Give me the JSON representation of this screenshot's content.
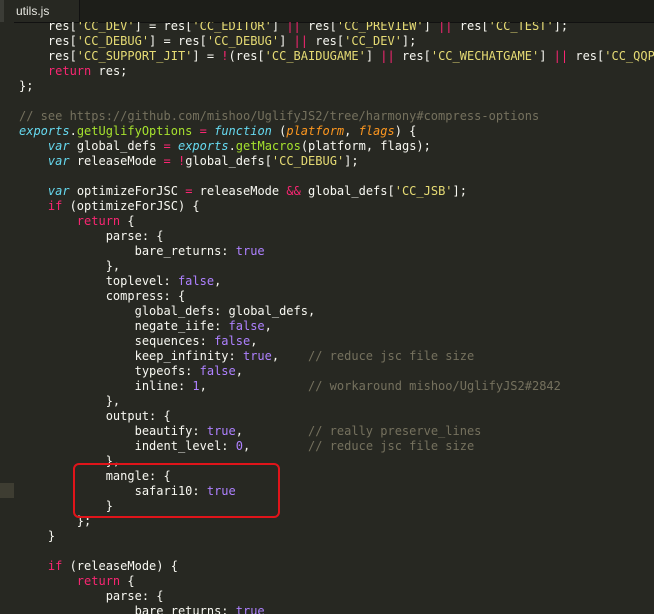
{
  "tab": {
    "label": "utils.js"
  },
  "lines": [
    [
      "    res[",
      {
        "t": "'CC_DEV'",
        "c": "str"
      },
      "] = res[",
      {
        "t": "'CC_EDITOR'",
        "c": "str"
      },
      "] ",
      {
        "t": "||",
        "c": "kw"
      },
      " res[",
      {
        "t": "'CC_PREVIEW'",
        "c": "str"
      },
      "] ",
      {
        "t": "||",
        "c": "kw"
      },
      " res[",
      {
        "t": "'CC_TEST'",
        "c": "str"
      },
      "];"
    ],
    [
      "    res[",
      {
        "t": "'CC_DEBUG'",
        "c": "str"
      },
      "] = res[",
      {
        "t": "'CC_DEBUG'",
        "c": "str"
      },
      "] ",
      {
        "t": "||",
        "c": "kw"
      },
      " res[",
      {
        "t": "'CC_DEV'",
        "c": "str"
      },
      "];"
    ],
    [
      "    res[",
      {
        "t": "'CC_SUPPORT_JIT'",
        "c": "str"
      },
      "] = ",
      {
        "t": "!",
        "c": "kw"
      },
      "(res[",
      {
        "t": "'CC_BAIDUGAME'",
        "c": "str"
      },
      "] ",
      {
        "t": "||",
        "c": "kw"
      },
      " res[",
      {
        "t": "'CC_WECHATGAME'",
        "c": "str"
      },
      "] ",
      {
        "t": "||",
        "c": "kw"
      },
      " res[",
      {
        "t": "'CC_QQPLAY",
        "c": "str"
      }
    ],
    [
      "    ",
      {
        "t": "return",
        "c": "kw"
      },
      " res;"
    ],
    [
      "};"
    ],
    [
      ""
    ],
    [
      {
        "t": "// see https://github.com/mishoo/UglifyJS2/tree/harmony#compress-options",
        "c": "cmt"
      }
    ],
    [
      {
        "t": "exports",
        "c": "kwi"
      },
      ".",
      {
        "t": "getUglifyOptions",
        "c": "fn"
      },
      " ",
      {
        "t": "=",
        "c": "kw"
      },
      " ",
      {
        "t": "function",
        "c": "kwi"
      },
      " (",
      {
        "t": "platform",
        "c": "par"
      },
      ", ",
      {
        "t": "flags",
        "c": "par"
      },
      ") {"
    ],
    [
      "    ",
      {
        "t": "var",
        "c": "kwi"
      },
      " global_defs ",
      {
        "t": "=",
        "c": "kw"
      },
      " ",
      {
        "t": "exports",
        "c": "kwi"
      },
      ".",
      {
        "t": "getMacros",
        "c": "fn"
      },
      "(platform, flags);"
    ],
    [
      "    ",
      {
        "t": "var",
        "c": "kwi"
      },
      " releaseMode ",
      {
        "t": "=",
        "c": "kw"
      },
      " ",
      {
        "t": "!",
        "c": "kw"
      },
      "global_defs[",
      {
        "t": "'CC_DEBUG'",
        "c": "str"
      },
      "];"
    ],
    [
      ""
    ],
    [
      "    ",
      {
        "t": "var",
        "c": "kwi"
      },
      " optimizeForJSC ",
      {
        "t": "=",
        "c": "kw"
      },
      " releaseMode ",
      {
        "t": "&&",
        "c": "kw"
      },
      " global_defs[",
      {
        "t": "'CC_JSB'",
        "c": "str"
      },
      "];"
    ],
    [
      "    ",
      {
        "t": "if",
        "c": "kw"
      },
      " (optimizeForJSC) {"
    ],
    [
      "        ",
      {
        "t": "return",
        "c": "kw"
      },
      " {"
    ],
    [
      "            parse: {"
    ],
    [
      "                bare_returns: ",
      {
        "t": "true",
        "c": "num"
      }
    ],
    [
      "            },"
    ],
    [
      "            toplevel: ",
      {
        "t": "false",
        "c": "num"
      },
      ","
    ],
    [
      "            compress: {"
    ],
    [
      "                global_defs: global_defs,"
    ],
    [
      "                negate_iife: ",
      {
        "t": "false",
        "c": "num"
      },
      ","
    ],
    [
      "                sequences: ",
      {
        "t": "false",
        "c": "num"
      },
      ","
    ],
    [
      "                keep_infinity: ",
      {
        "t": "true",
        "c": "num"
      },
      ",    ",
      {
        "t": "// reduce jsc file size",
        "c": "cmt"
      }
    ],
    [
      "                typeofs: ",
      {
        "t": "false",
        "c": "num"
      },
      ","
    ],
    [
      "                inline: ",
      {
        "t": "1",
        "c": "num"
      },
      ",              ",
      {
        "t": "// workaround mishoo/UglifyJS2#2842",
        "c": "cmt"
      }
    ],
    [
      "            },"
    ],
    [
      "            output: {"
    ],
    [
      "                beautify: ",
      {
        "t": "true",
        "c": "num"
      },
      ",         ",
      {
        "t": "// really preserve_lines",
        "c": "cmt"
      }
    ],
    [
      "                indent_level: ",
      {
        "t": "0",
        "c": "num"
      },
      ",        ",
      {
        "t": "// reduce jsc file size",
        "c": "cmt"
      }
    ],
    [
      "            },"
    ],
    [
      "            mangle: {"
    ],
    [
      "                safari10: ",
      {
        "t": "true",
        "c": "num"
      }
    ],
    [
      "            }"
    ],
    [
      "        };"
    ],
    [
      "    }"
    ],
    [
      ""
    ],
    [
      "    ",
      {
        "t": "if",
        "c": "kw"
      },
      " (releaseMode) {"
    ],
    [
      "        ",
      {
        "t": "return",
        "c": "kw"
      },
      " {"
    ],
    [
      "            parse: {"
    ],
    [
      "                bare_returns: ",
      {
        "t": "true",
        "c": "num"
      }
    ]
  ]
}
